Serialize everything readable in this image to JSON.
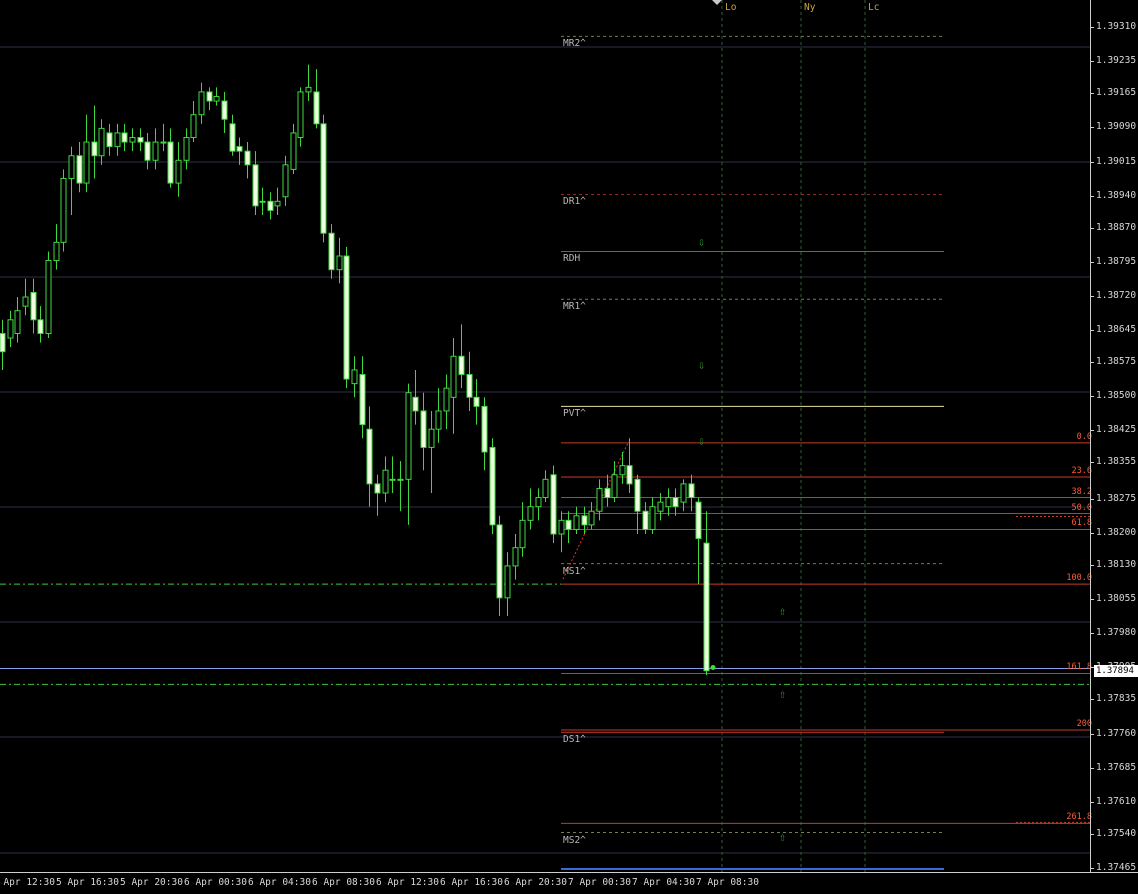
{
  "chart_data": {
    "type": "candlestick",
    "price_scale": {
      "ticks": [
        "1.39310",
        "1.39235",
        "1.39165",
        "1.39090",
        "1.39015",
        "1.38940",
        "1.38870",
        "1.38795",
        "1.38720",
        "1.38645",
        "1.38575",
        "1.38500",
        "1.38425",
        "1.38355",
        "1.38275",
        "1.38200",
        "1.38130",
        "1.38055",
        "1.37980",
        "1.37905",
        "1.37835",
        "1.37760",
        "1.37685",
        "1.37610",
        "1.37540",
        "1.37465"
      ],
      "min": 1.37465,
      "max": 1.3933
    },
    "time_scale": {
      "ticks": [
        "5 Apr 12:30",
        "5 Apr 16:30",
        "5 Apr 20:30",
        "6 Apr 00:30",
        "6 Apr 04:30",
        "6 Apr 08:30",
        "6 Apr 12:30",
        "6 Apr 16:30",
        "6 Apr 20:30",
        "7 Apr 00:30",
        "7 Apr 04:30",
        "7 Apr 08:30"
      ]
    },
    "current_price": "1.37894",
    "current_price_behind": "1.37905",
    "session_labels": [
      "Lo",
      "Ny",
      "Lc"
    ],
    "levels": [
      {
        "name": "MR2^",
        "price": 1.39292,
        "style": "dashed",
        "color": "#7a7a4a"
      },
      {
        "name": "DR1^",
        "price": 1.38945,
        "style": "dashed",
        "color": "#8a2a1a"
      },
      {
        "name": "RDH",
        "price": 1.3882,
        "style": "solid",
        "color": "#d03a2a"
      },
      {
        "name": "MR1^",
        "price": 1.38715,
        "style": "dashed",
        "color": "#7a7a4a"
      },
      {
        "name": "PVT^",
        "price": 1.3848,
        "style": "solid",
        "color": "#e8e0a0"
      },
      {
        "name": "MS1^",
        "price": 1.38135,
        "style": "dashed",
        "color": "#7a7a4a"
      },
      {
        "name": "DS1^",
        "price": 1.37765,
        "style": "solid",
        "color": "#d03a2a"
      },
      {
        "name": "MS2^",
        "price": 1.37545,
        "style": "dashed",
        "color": "#7a7a4a"
      }
    ],
    "fibonacci": [
      {
        "label": "0.0",
        "price": 1.384
      },
      {
        "label": "23.6",
        "price": 1.38325
      },
      {
        "label": "38.2",
        "price": 1.3828
      },
      {
        "label": "50.0",
        "price": 1.38245
      },
      {
        "label": "61.8",
        "price": 1.3821
      },
      {
        "label": "100.0",
        "price": 1.3809
      },
      {
        "label": "161.8",
        "price": 1.37894
      },
      {
        "label": "200",
        "price": 1.3777
      },
      {
        "label": "261.8",
        "price": 1.37565
      }
    ],
    "signals": [
      {
        "dir": "down",
        "price": 1.3884
      },
      {
        "dir": "down",
        "price": 1.3857
      },
      {
        "dir": "down",
        "price": 1.38405
      },
      {
        "dir": "up",
        "price": 1.3803
      },
      {
        "dir": "up",
        "price": 1.3785
      },
      {
        "dir": "up",
        "price": 1.37535
      }
    ],
    "candles": [
      [
        1.3864,
        1.386,
        1.3867,
        1.3856
      ],
      [
        1.3863,
        1.3867,
        1.3869,
        1.3861
      ],
      [
        1.3864,
        1.3869,
        1.3872,
        1.3862
      ],
      [
        1.387,
        1.3872,
        1.3876,
        1.3868
      ],
      [
        1.3873,
        1.3867,
        1.3876,
        1.3864
      ],
      [
        1.3867,
        1.3864,
        1.387,
        1.3862
      ],
      [
        1.3864,
        1.388,
        1.3882,
        1.3863
      ],
      [
        1.388,
        1.3884,
        1.3888,
        1.3878
      ],
      [
        1.3884,
        1.3898,
        1.39,
        1.3882
      ],
      [
        1.3898,
        1.3903,
        1.3905,
        1.389
      ],
      [
        1.3903,
        1.3897,
        1.3906,
        1.3895
      ],
      [
        1.3897,
        1.3906,
        1.3912,
        1.3895
      ],
      [
        1.3906,
        1.3903,
        1.3914,
        1.3898
      ],
      [
        1.3903,
        1.3909,
        1.3911,
        1.3901
      ],
      [
        1.3908,
        1.3905,
        1.391,
        1.3903
      ],
      [
        1.3905,
        1.3908,
        1.391,
        1.3903
      ],
      [
        1.3908,
        1.3906,
        1.391,
        1.3904
      ],
      [
        1.3906,
        1.3907,
        1.3909,
        1.3904
      ],
      [
        1.3907,
        1.3906,
        1.3909,
        1.3904
      ],
      [
        1.3906,
        1.3902,
        1.3908,
        1.39
      ],
      [
        1.3902,
        1.3906,
        1.3909,
        1.39
      ],
      [
        1.3906,
        1.3906,
        1.391,
        1.3904
      ],
      [
        1.3906,
        1.3897,
        1.3909,
        1.3896
      ],
      [
        1.3897,
        1.3902,
        1.3906,
        1.3894
      ],
      [
        1.3902,
        1.3907,
        1.3909,
        1.39
      ],
      [
        1.3907,
        1.3912,
        1.3915,
        1.3906
      ],
      [
        1.3912,
        1.3917,
        1.3919,
        1.391
      ],
      [
        1.3917,
        1.3915,
        1.3918,
        1.3913
      ],
      [
        1.3915,
        1.3916,
        1.3918,
        1.3914
      ],
      [
        1.3915,
        1.3911,
        1.3917,
        1.3908
      ],
      [
        1.391,
        1.3904,
        1.3912,
        1.3903
      ],
      [
        1.3905,
        1.3904,
        1.3907,
        1.3901
      ],
      [
        1.3904,
        1.3901,
        1.3906,
        1.3898
      ],
      [
        1.3901,
        1.3892,
        1.3904,
        1.389
      ],
      [
        1.3893,
        1.3893,
        1.3896,
        1.389
      ],
      [
        1.3893,
        1.3891,
        1.3895,
        1.3889
      ],
      [
        1.3892,
        1.3893,
        1.3896,
        1.389
      ],
      [
        1.3894,
        1.3901,
        1.3903,
        1.3892
      ],
      [
        1.39,
        1.3908,
        1.391,
        1.3899
      ],
      [
        1.3907,
        1.3917,
        1.3918,
        1.3905
      ],
      [
        1.3917,
        1.3918,
        1.3923,
        1.3915
      ],
      [
        1.3917,
        1.391,
        1.3922,
        1.3909
      ],
      [
        1.391,
        1.3886,
        1.3912,
        1.3884
      ],
      [
        1.3886,
        1.3878,
        1.3888,
        1.3876
      ],
      [
        1.3878,
        1.3881,
        1.3885,
        1.3875
      ],
      [
        1.3881,
        1.3854,
        1.3883,
        1.3852
      ],
      [
        1.3853,
        1.3856,
        1.3859,
        1.385
      ],
      [
        1.3855,
        1.3844,
        1.3859,
        1.3841
      ],
      [
        1.3843,
        1.3831,
        1.3848,
        1.3826
      ],
      [
        1.3831,
        1.3829,
        1.3833,
        1.3824
      ],
      [
        1.3829,
        1.3834,
        1.3837,
        1.3827
      ],
      [
        1.3832,
        1.3832,
        1.3837,
        1.3829
      ],
      [
        1.3832,
        1.3832,
        1.3836,
        1.3825
      ],
      [
        1.3832,
        1.3851,
        1.3853,
        1.3822
      ],
      [
        1.385,
        1.3847,
        1.3856,
        1.3844
      ],
      [
        1.3847,
        1.3839,
        1.3851,
        1.3834
      ],
      [
        1.3839,
        1.3843,
        1.3847,
        1.3829
      ],
      [
        1.3843,
        1.3847,
        1.3852,
        1.384
      ],
      [
        1.3847,
        1.3852,
        1.3855,
        1.3843
      ],
      [
        1.385,
        1.3859,
        1.3863,
        1.3842
      ],
      [
        1.3859,
        1.3855,
        1.3866,
        1.3852
      ],
      [
        1.3855,
        1.385,
        1.386,
        1.3847
      ],
      [
        1.385,
        1.3848,
        1.3854,
        1.3844
      ],
      [
        1.3848,
        1.3838,
        1.385,
        1.3834
      ],
      [
        1.3839,
        1.3822,
        1.3841,
        1.382
      ],
      [
        1.3822,
        1.3806,
        1.3824,
        1.3802
      ],
      [
        1.3806,
        1.3813,
        1.3816,
        1.3802
      ],
      [
        1.3813,
        1.3817,
        1.382,
        1.381
      ],
      [
        1.3817,
        1.3823,
        1.3827,
        1.3815
      ],
      [
        1.3823,
        1.3826,
        1.383,
        1.3821
      ],
      [
        1.3826,
        1.3828,
        1.383,
        1.3823
      ],
      [
        1.3828,
        1.3832,
        1.3834,
        1.3827
      ],
      [
        1.3833,
        1.382,
        1.3835,
        1.3818
      ],
      [
        1.382,
        1.3823,
        1.3825,
        1.3816
      ],
      [
        1.3823,
        1.3821,
        1.3825,
        1.3818
      ],
      [
        1.3821,
        1.3824,
        1.3826,
        1.382
      ],
      [
        1.3824,
        1.3822,
        1.3826,
        1.382
      ],
      [
        1.3822,
        1.3825,
        1.3827,
        1.3821
      ],
      [
        1.3825,
        1.383,
        1.3832,
        1.3823
      ],
      [
        1.383,
        1.3828,
        1.3833,
        1.3826
      ],
      [
        1.3828,
        1.3833,
        1.3836,
        1.3827
      ],
      [
        1.3833,
        1.3835,
        1.3838,
        1.3831
      ],
      [
        1.3835,
        1.3831,
        1.3841,
        1.3829
      ],
      [
        1.3832,
        1.3825,
        1.3833,
        1.382
      ],
      [
        1.3825,
        1.3821,
        1.3827,
        1.382
      ],
      [
        1.3821,
        1.3826,
        1.3828,
        1.382
      ],
      [
        1.3825,
        1.3827,
        1.3829,
        1.3823
      ],
      [
        1.3826,
        1.3828,
        1.383,
        1.3824
      ],
      [
        1.3828,
        1.3826,
        1.383,
        1.3824
      ],
      [
        1.3827,
        1.3831,
        1.3832,
        1.3825
      ],
      [
        1.3831,
        1.3828,
        1.3833,
        1.3825
      ],
      [
        1.3827,
        1.3819,
        1.3828,
        1.3809
      ],
      [
        1.3818,
        1.379,
        1.3825,
        1.3789
      ]
    ]
  }
}
